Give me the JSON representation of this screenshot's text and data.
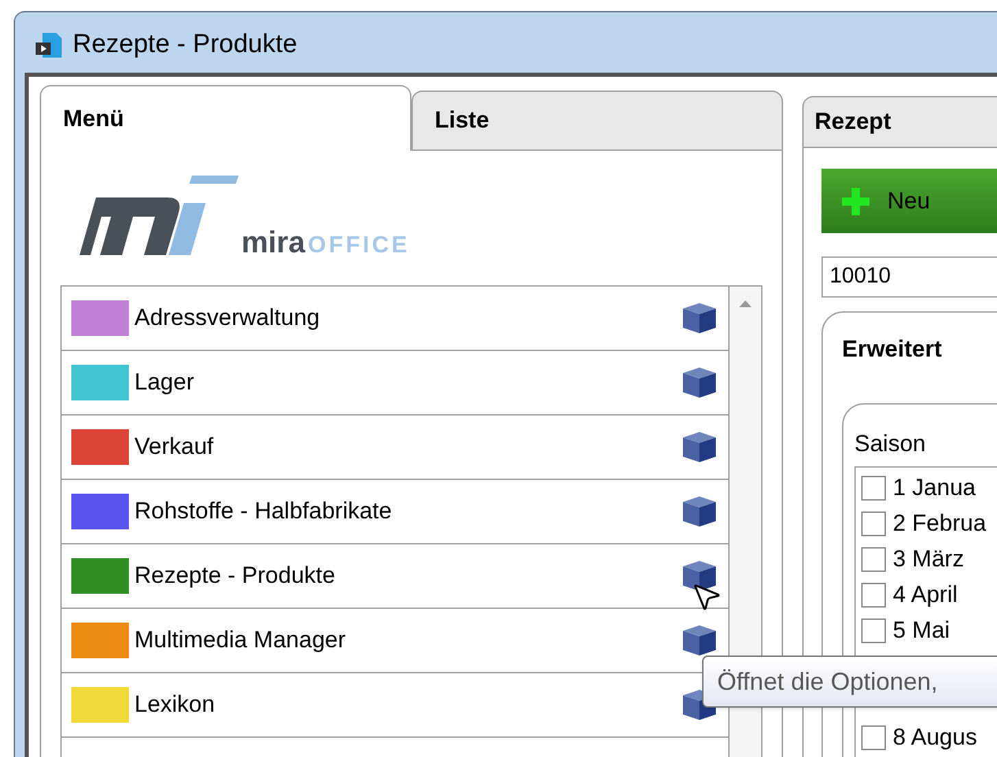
{
  "window": {
    "title": "Rezepte - Produkte"
  },
  "tabs": [
    {
      "label": "Menü",
      "selected": true
    },
    {
      "label": "Liste",
      "selected": false
    }
  ],
  "logo": {
    "brand": "mira",
    "suffix": "OFFICE"
  },
  "menu_items": [
    {
      "label": "Adressverwaltung",
      "color": "#c17fd6"
    },
    {
      "label": "Lager",
      "color": "#3fc6d0"
    },
    {
      "label": "Verkauf",
      "color": "#dd4438"
    },
    {
      "label": "Rohstoffe - Halbfabrikate",
      "color": "#5a55f0"
    },
    {
      "label": "Rezepte - Produkte",
      "color": "#2f8f22"
    },
    {
      "label": "Multimedia Manager",
      "color": "#ec8a12"
    },
    {
      "label": "Lexikon",
      "color": "#f2d93a"
    }
  ],
  "detail": {
    "tab": "Rezept",
    "new_button": "Neu",
    "number_field": "10010",
    "section": "Erweitert",
    "season": {
      "title": "Saison",
      "months": [
        {
          "label": "1 Janua",
          "checked": false
        },
        {
          "label": "2 Februa",
          "checked": false
        },
        {
          "label": "3 März",
          "checked": false
        },
        {
          "label": "4 April",
          "checked": false
        },
        {
          "label": "5 Mai",
          "checked": false
        },
        {
          "label": "8 Augus",
          "checked": false
        }
      ]
    }
  },
  "tooltip": "Öffnet die Optionen,"
}
